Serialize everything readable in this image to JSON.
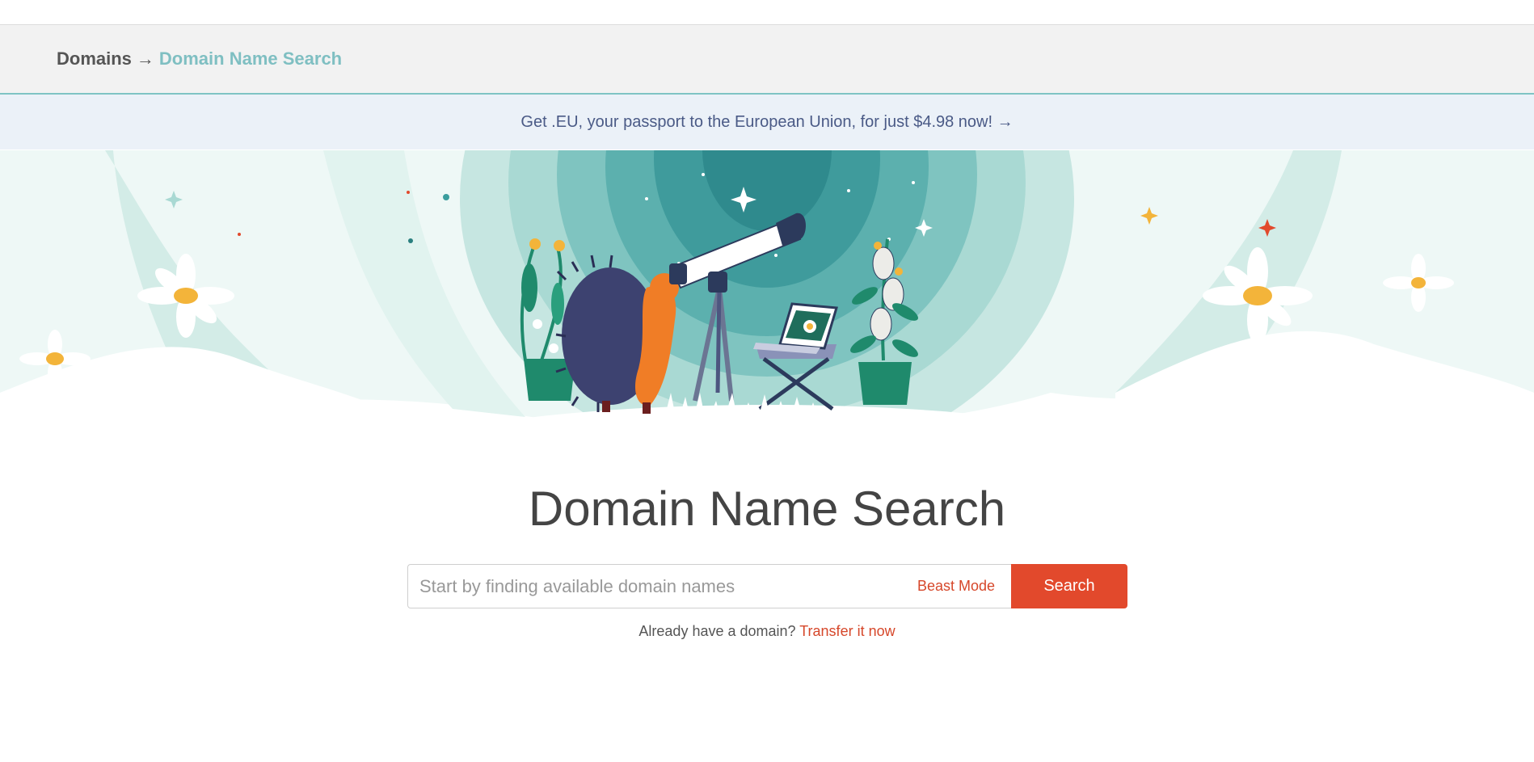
{
  "breadcrumb": {
    "root": "Domains",
    "separator": "→",
    "current": "Domain Name Search"
  },
  "promo": {
    "text": "Get .EU, your passport to the European Union, for just $4.98 now! →"
  },
  "hero": {
    "illustration": "hedgehog-with-telescope",
    "colors": {
      "teal": "#3a9d9d",
      "mint": "#d7f0ec",
      "orange": "#f07d26",
      "navy": "#2c3a5c"
    }
  },
  "main": {
    "title": "Domain Name Search"
  },
  "search": {
    "placeholder": "Start by finding available domain names",
    "value": "",
    "beast_mode_label": "Beast Mode",
    "button_label": "Search"
  },
  "transfer": {
    "prompt": "Already have a domain?",
    "link_label": "Transfer it now"
  },
  "colors": {
    "accent": "#e2492c",
    "breadcrumb_highlight": "#7fbfc2",
    "promo_background": "#ebf1f8"
  }
}
